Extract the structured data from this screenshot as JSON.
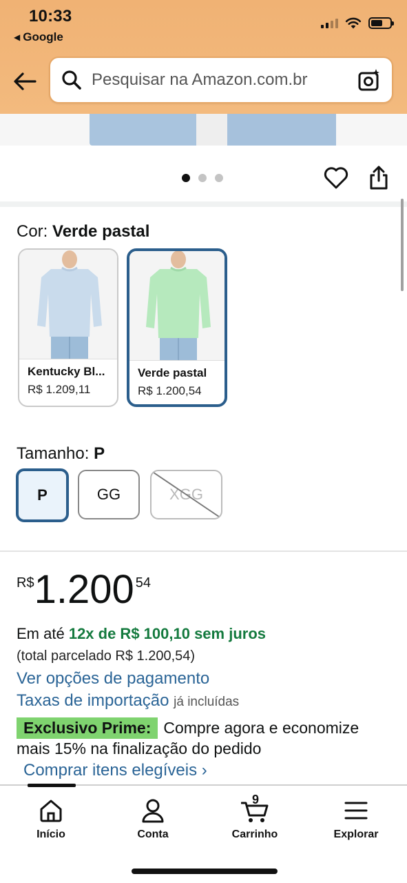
{
  "status_bar": {
    "time": "10:33",
    "back_app": "Google"
  },
  "search": {
    "placeholder": "Pesquisar na Amazon.com.br"
  },
  "carousel": {
    "dot_count": 3,
    "active_index": 0
  },
  "color": {
    "label": "Cor:",
    "selected": "Verde pastal",
    "options": [
      {
        "name": "Kentucky Bl...",
        "price": "R$ 1.209,11",
        "shirt_color": "#c9dbec"
      },
      {
        "name": "Verde pastal",
        "price": "R$ 1.200,54",
        "shirt_color": "#b6e9bd"
      }
    ]
  },
  "size": {
    "label": "Tamanho:",
    "selected": "P",
    "options": [
      "P",
      "GG",
      "XGG"
    ]
  },
  "price": {
    "currency": "R$",
    "whole": "1.200",
    "cents": "54"
  },
  "installments": {
    "prefix": "Em até",
    "highlight": "12x de R$ 100,10 sem juros",
    "total": "(total parcelado R$ 1.200,54)"
  },
  "links": {
    "payment_options": "Ver opções de pagamento",
    "import_taxes": "Taxas de importação",
    "import_taxes_note": "já incluídas"
  },
  "prime": {
    "badge": "Exclusivo Prime:",
    "text_line1": "Compre agora e economize",
    "text_line2": "mais 15% na finalização do pedido",
    "link": "Comprar itens elegíveis ›"
  },
  "bottom_nav": {
    "home": "Início",
    "account": "Conta",
    "cart": "Carrinho",
    "cart_count": "9",
    "explore": "Explorar"
  },
  "colors": {
    "header": "#f3b779",
    "link": "#2a6496",
    "selected_border": "#2b5e8c",
    "installment_green": "#147a3e",
    "prime_badge": "#7fd36f"
  }
}
